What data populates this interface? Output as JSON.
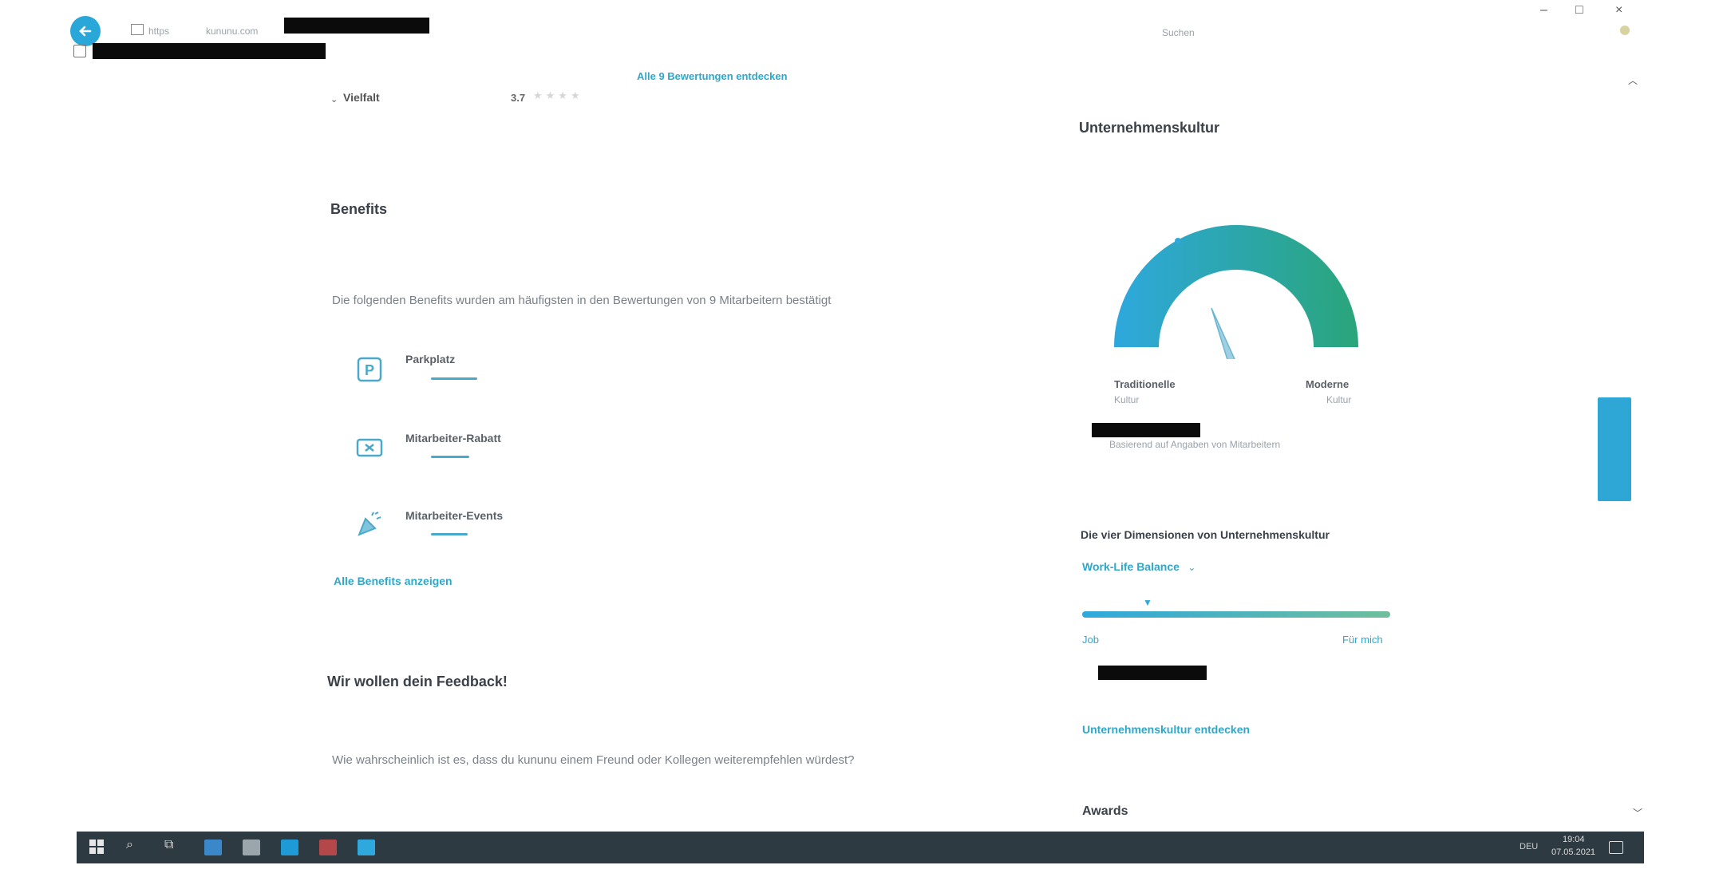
{
  "browser": {
    "url_scheme": "https",
    "url_domain": "kununu.com",
    "search_label": "Suchen"
  },
  "left": {
    "top_link": "Alle 9 Bewertungen entdecken",
    "vielfalt": {
      "label": "Vielfalt",
      "score": "3.7"
    },
    "benefits": {
      "title": "Benefits",
      "intro": "Die folgenden Benefits wurden am häufigsten in den Bewertungen von 9 Mitarbeitern bestätigt",
      "items": [
        {
          "label": "Parkplatz",
          "icon": "parking-icon"
        },
        {
          "label": "Mitarbeiter-Rabatt",
          "icon": "discount-ticket-icon"
        },
        {
          "label": "Mitarbeiter-Events",
          "icon": "party-icon"
        }
      ],
      "show_all": "Alle Benefits anzeigen"
    },
    "feedback": {
      "title": "Wir wollen dein Feedback!",
      "question": "Wie wahrscheinlich ist es, dass du kununu einem Freund oder Kollegen weiterempfehlen würdest?"
    }
  },
  "right": {
    "culture": {
      "title": "Unternehmenskultur",
      "gauge_left": "Traditionelle",
      "gauge_left_sub": "Kultur",
      "gauge_right": "Moderne",
      "gauge_right_sub": "Kultur",
      "note": "Basierend auf Angaben von Mitarbeitern"
    },
    "dimensions": {
      "title": "Die vier Dimensionen von Unternehmenskultur",
      "selected": "Work-Life Balance",
      "left_label": "Job",
      "right_label": "Für mich"
    },
    "explore_link": "Unternehmenskultur entdecken",
    "awards_title": "Awards"
  },
  "taskbar": {
    "time": "19:04",
    "date": "07.05.2021",
    "lang": "DEU"
  },
  "colors": {
    "accent": "#2fa7c9",
    "gauge_start": "#2ea8dd",
    "gauge_end": "#2aa57a",
    "taskbar": "#2e3a42"
  }
}
